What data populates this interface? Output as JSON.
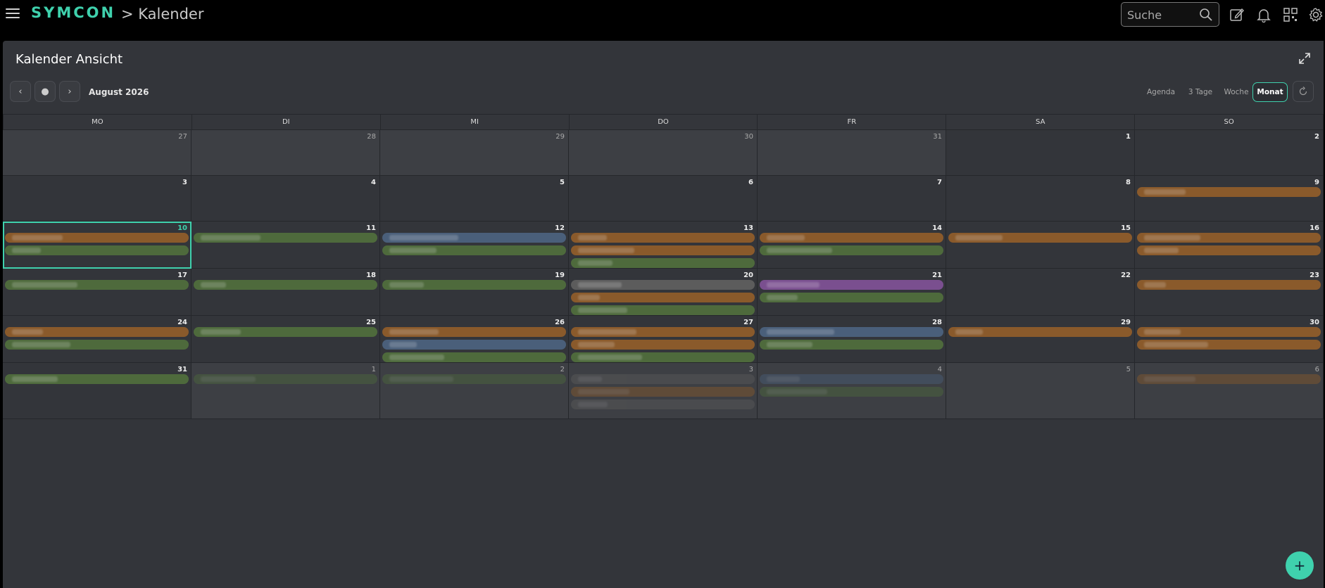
{
  "header": {
    "brand": "SYMCON",
    "breadcrumb": "> Kalender",
    "search_placeholder": "Suche"
  },
  "panel": {
    "title": "Kalender Ansicht",
    "month_label": "August 2026",
    "nav": {
      "prev": "‹",
      "today": "●",
      "next": "›"
    },
    "views": [
      {
        "label": "Agenda",
        "active": false
      },
      {
        "label": "3 Tage",
        "active": false
      },
      {
        "label": "Woche",
        "active": false
      },
      {
        "label": "Monat",
        "active": true
      }
    ]
  },
  "calendar": {
    "weekdays": [
      "MO",
      "DI",
      "MI",
      "DO",
      "FR",
      "SA",
      "SO"
    ],
    "weeks": [
      {
        "days": [
          {
            "num": "27",
            "other": true,
            "events": []
          },
          {
            "num": "28",
            "other": true,
            "events": []
          },
          {
            "num": "29",
            "other": true,
            "events": []
          },
          {
            "num": "30",
            "other": true,
            "events": []
          },
          {
            "num": "31",
            "other": true,
            "events": []
          },
          {
            "num": "1",
            "other": false,
            "events": []
          },
          {
            "num": "2",
            "other": false,
            "events": []
          }
        ]
      },
      {
        "days": [
          {
            "num": "3",
            "other": false,
            "events": []
          },
          {
            "num": "4",
            "other": false,
            "events": []
          },
          {
            "num": "5",
            "other": false,
            "events": []
          },
          {
            "num": "6",
            "other": false,
            "events": []
          },
          {
            "num": "7",
            "other": false,
            "events": []
          },
          {
            "num": "8",
            "other": false,
            "events": []
          },
          {
            "num": "9",
            "other": false,
            "events": [
              "orange"
            ]
          }
        ]
      },
      {
        "days": [
          {
            "num": "10",
            "other": false,
            "today": true,
            "events": [
              "orange",
              "green"
            ]
          },
          {
            "num": "11",
            "other": false,
            "events": [
              "green"
            ]
          },
          {
            "num": "12",
            "other": false,
            "events": [
              "blue",
              "green"
            ]
          },
          {
            "num": "13",
            "other": false,
            "events": [
              "orange",
              "orange",
              "green"
            ]
          },
          {
            "num": "14",
            "other": false,
            "events": [
              "orange",
              "green"
            ]
          },
          {
            "num": "15",
            "other": false,
            "events": [
              "orange"
            ]
          },
          {
            "num": "16",
            "other": false,
            "events": [
              "orange",
              "orange"
            ]
          }
        ]
      },
      {
        "days": [
          {
            "num": "17",
            "other": false,
            "events": [
              "green"
            ]
          },
          {
            "num": "18",
            "other": false,
            "events": [
              "green"
            ]
          },
          {
            "num": "19",
            "other": false,
            "events": [
              "green"
            ]
          },
          {
            "num": "20",
            "other": false,
            "events": [
              "gray",
              "orange",
              "green"
            ]
          },
          {
            "num": "21",
            "other": false,
            "events": [
              "purple",
              "green"
            ]
          },
          {
            "num": "22",
            "other": false,
            "events": []
          },
          {
            "num": "23",
            "other": false,
            "events": [
              "orange"
            ]
          }
        ]
      },
      {
        "days": [
          {
            "num": "24",
            "other": false,
            "events": [
              "orange",
              "green"
            ]
          },
          {
            "num": "25",
            "other": false,
            "events": [
              "green"
            ]
          },
          {
            "num": "26",
            "other": false,
            "events": [
              "orange",
              "blue",
              "green"
            ]
          },
          {
            "num": "27",
            "other": false,
            "events": [
              "orange",
              "orange",
              "green"
            ]
          },
          {
            "num": "28",
            "other": false,
            "events": [
              "blue",
              "green"
            ]
          },
          {
            "num": "29",
            "other": false,
            "events": [
              "orange"
            ]
          },
          {
            "num": "30",
            "other": false,
            "events": [
              "orange",
              "orange"
            ]
          }
        ]
      },
      {
        "days": [
          {
            "num": "31",
            "other": false,
            "events": [
              "green"
            ]
          },
          {
            "num": "1",
            "other": true,
            "events": [
              "green"
            ]
          },
          {
            "num": "2",
            "other": true,
            "events": [
              "green"
            ]
          },
          {
            "num": "3",
            "other": true,
            "events": [
              "gray",
              "orange",
              "gray"
            ]
          },
          {
            "num": "4",
            "other": true,
            "events": [
              "blue",
              "green"
            ]
          },
          {
            "num": "5",
            "other": true,
            "events": []
          },
          {
            "num": "6",
            "other": true,
            "events": [
              "orange"
            ]
          }
        ]
      }
    ]
  },
  "colors": {
    "accent": "#3fd1ad",
    "orange": "#8a5a2b",
    "green": "#4e6a3c",
    "blue": "#4a5f7a",
    "purple": "#7a4f8f",
    "gray": "#5c5c5c"
  },
  "icons": {
    "menu": "hamburger-icon",
    "search": "search-icon",
    "edit": "edit-icon",
    "notifications": "bell-icon",
    "qr": "qr-code-icon",
    "settings": "gear-icon",
    "expand": "expand-icon",
    "refresh": "refresh-icon",
    "add": "plus-icon"
  },
  "fab_label": "+"
}
